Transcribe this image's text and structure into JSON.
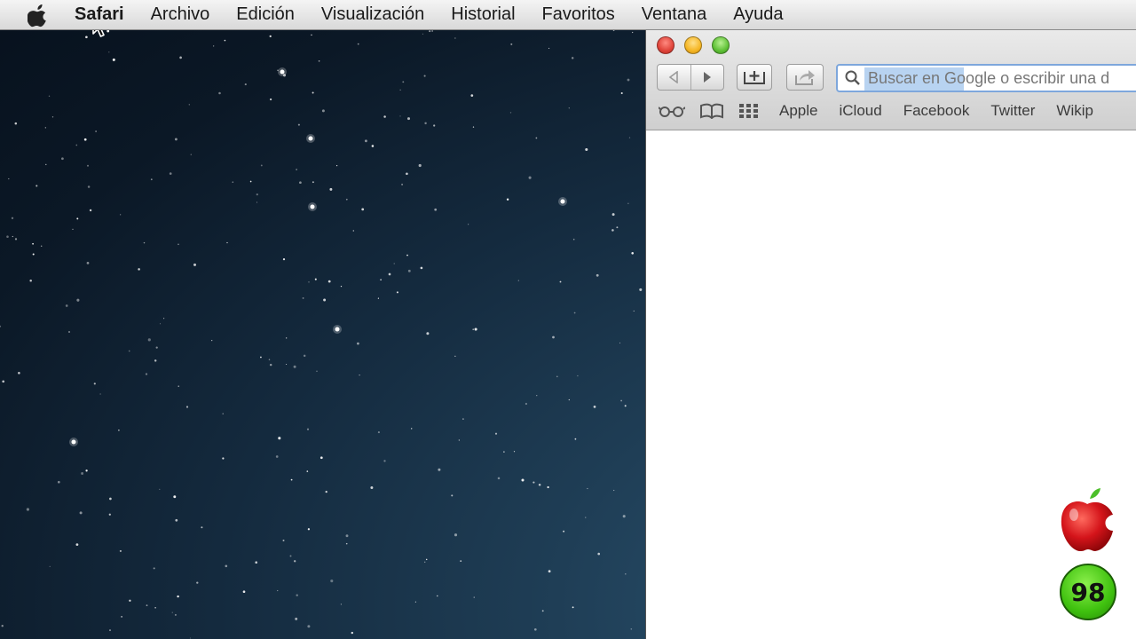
{
  "menubar": {
    "apple_icon": "apple-logo-icon",
    "items": [
      "Safari",
      "Archivo",
      "Edición",
      "Visualización",
      "Historial",
      "Favoritos",
      "Ventana",
      "Ayuda"
    ]
  },
  "safari": {
    "toolbar": {
      "back_icon": "back-arrow-icon",
      "forward_icon": "forward-arrow-icon",
      "add_icon": "add-bookmark-icon",
      "share_icon": "share-icon",
      "search_placeholder": "Buscar en Google o escribir una d"
    },
    "bookmarks": {
      "icons": [
        "reading-list-icon",
        "bookmarks-book-icon",
        "top-sites-grid-icon"
      ],
      "links": [
        "Apple",
        "iCloud",
        "Facebook",
        "Twitter",
        "Wikip"
      ]
    }
  },
  "badge": {
    "number": "98"
  },
  "colors": {
    "close": "#e0443a",
    "minimize": "#f5b624",
    "zoom": "#5fc136",
    "search_highlight": "#b8d3f1"
  }
}
